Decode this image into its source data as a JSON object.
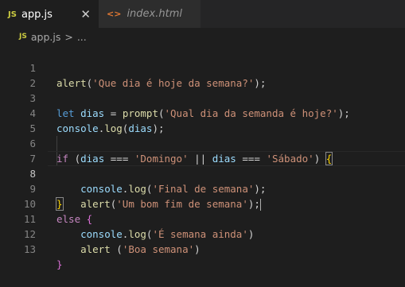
{
  "tabs": [
    {
      "badge": "JS",
      "label": "app.js",
      "close": "✕"
    },
    {
      "badge": "<>",
      "label": "index.html"
    }
  ],
  "breadcrumb": {
    "badge": "JS",
    "file": "app.js",
    "sep": ">",
    "rest": "..."
  },
  "editor": {
    "line_numbers": [
      "1",
      "2",
      "3",
      "4",
      "5",
      "6",
      "7",
      "8",
      "9",
      "10",
      "11",
      "12",
      "13"
    ],
    "current_line": "8"
  },
  "code_text": {
    "l1_fn": "alert",
    "l1_str": "'Que dia é hoje da semana?'",
    "l3_let": "let",
    "l3_var": "dias",
    "l3_eq": "=",
    "l3_fn": "prompt",
    "l3_str": "'Qual dia da semanda é hoje?'",
    "l4_obj": "console",
    "l4_fn": "log",
    "l4_var": "dias",
    "l6_if": "if",
    "l6_var1": "dias",
    "l6_op1": "===",
    "l6_str1": "'Domingo'",
    "l6_or": "||",
    "l6_var2": "dias",
    "l6_op2": "===",
    "l6_str2": "'Sábado'",
    "l7_obj": "console",
    "l7_fn": "log",
    "l7_str": "'Final de semana'",
    "l8_fn": "alert",
    "l8_str": "'Um bom fim de semana'",
    "l10_else": "else",
    "l11_obj": "console",
    "l11_fn": "log",
    "l11_str": "'É semana ainda'",
    "l12_fn": "alert",
    "l12_str": "'Boa semana'"
  }
}
